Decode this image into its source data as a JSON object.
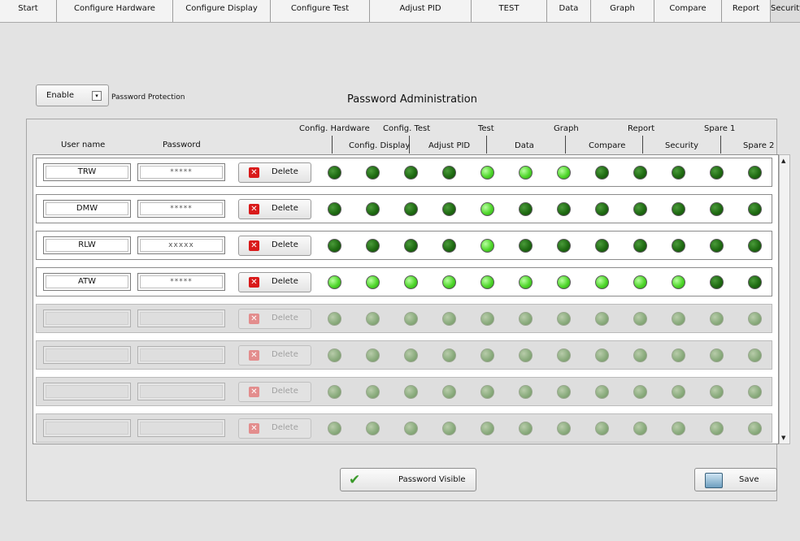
{
  "tabs": [
    {
      "label": "Start"
    },
    {
      "label": "Configure Hardware"
    },
    {
      "label": "Configure Display"
    },
    {
      "label": "Configure Test"
    },
    {
      "label": "Adjust PID"
    },
    {
      "label": "TEST"
    },
    {
      "label": "Data"
    },
    {
      "label": "Graph"
    },
    {
      "label": "Compare"
    },
    {
      "label": "Report"
    },
    {
      "label": "Security"
    }
  ],
  "active_tab": "Security",
  "protection": {
    "select_value": "Enable",
    "dropdown_icon": "chevron-down-icon",
    "label": "Password Protection"
  },
  "title": "Password Administration",
  "headers": {
    "user_name": "User name",
    "password": "Password",
    "permissions_top": [
      "Config. Hardware",
      "Config. Test",
      "Test",
      "Graph",
      "Report",
      "Spare 1"
    ],
    "permissions_bottom": [
      "Config. Display",
      "Adjust PID",
      "Data",
      "Compare",
      "Security",
      "Spare 2"
    ]
  },
  "delete_label": "Delete",
  "users": [
    {
      "name": "TRW",
      "password": "*****",
      "perms": [
        0,
        0,
        0,
        0,
        1,
        1,
        1,
        0,
        0,
        0,
        0,
        0
      ]
    },
    {
      "name": "DMW",
      "password": "*****",
      "perms": [
        0,
        0,
        0,
        0,
        1,
        0,
        0,
        0,
        0,
        0,
        0,
        0
      ]
    },
    {
      "name": "RLW",
      "password": "xxxxx",
      "perms": [
        0,
        0,
        0,
        0,
        1,
        0,
        0,
        0,
        0,
        0,
        0,
        0
      ]
    },
    {
      "name": "ATW",
      "password": "*****",
      "perms": [
        1,
        1,
        1,
        1,
        1,
        1,
        1,
        1,
        1,
        1,
        0,
        0
      ]
    },
    {
      "name": "",
      "password": "",
      "perms": [
        0,
        0,
        0,
        0,
        0,
        0,
        0,
        0,
        0,
        0,
        0,
        0
      ]
    },
    {
      "name": "",
      "password": "",
      "perms": [
        0,
        0,
        0,
        0,
        0,
        0,
        0,
        0,
        0,
        0,
        0,
        0
      ]
    },
    {
      "name": "",
      "password": "",
      "perms": [
        0,
        0,
        0,
        0,
        0,
        0,
        0,
        0,
        0,
        0,
        0,
        0
      ]
    },
    {
      "name": "",
      "password": "",
      "perms": [
        0,
        0,
        0,
        0,
        0,
        0,
        0,
        0,
        0,
        0,
        0,
        0
      ]
    }
  ],
  "active_user_count": 4,
  "led_colors": {
    "on": "#4fd62b",
    "off": "#1f6b12",
    "disabled": "#8cad7f"
  },
  "buttons": {
    "password_visible": "Password Visible",
    "password_visible_icon": "checkmark-icon",
    "save": "Save",
    "save_icon": "save-icon"
  },
  "scrollbar": {
    "up_icon": "scroll-up-icon",
    "down_icon": "scroll-down-icon"
  }
}
